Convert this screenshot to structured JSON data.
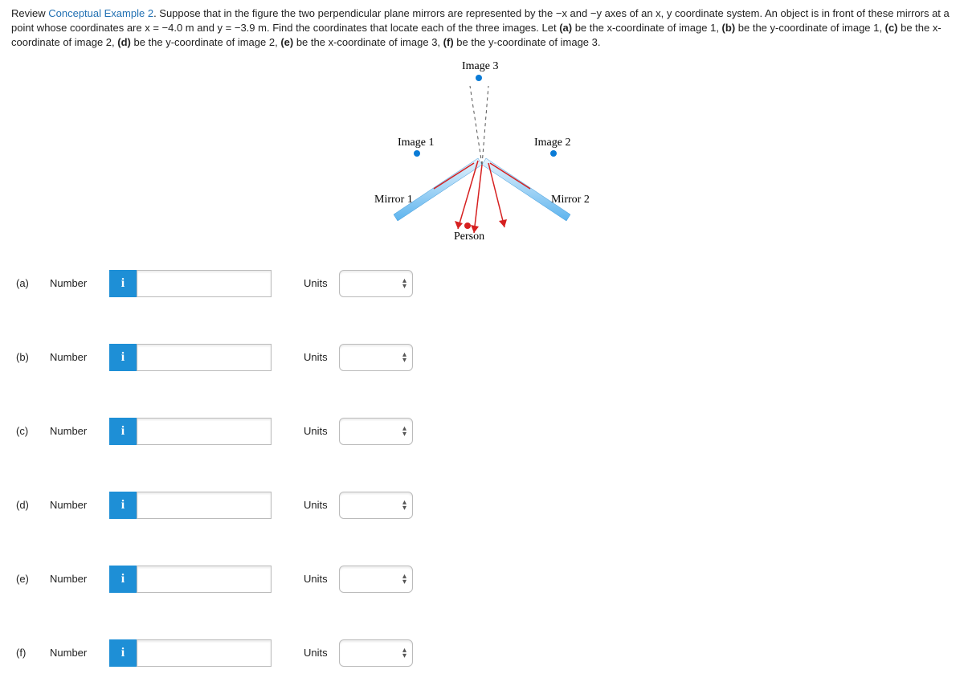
{
  "question": {
    "prefix": "Review ",
    "link": "Conceptual Example 2",
    "body1": ". Suppose that in the figure the two perpendicular plane mirrors are represented by the −x and −y axes of an x, y coordinate system. An object is in front of these mirrors at a point whose coordinates are x = −4.0 m and y = −3.9 m. Find the coordinates that locate each of the three images. Let ",
    "pa": "(a)",
    "ta": " be the x-coordinate of image 1, ",
    "pb": "(b)",
    "tb": " be the y-coordinate of image 1, ",
    "pc": "(c)",
    "tc": " be the x-coordinate of image 2, ",
    "pd": "(d)",
    "td": " be the y-coordinate of image 2, ",
    "pe": "(e)",
    "te": " be the x-coordinate of image 3, ",
    "pf": "(f)",
    "tf": " be the y-coordinate of image 3."
  },
  "figure": {
    "image3": "Image 3",
    "image1": "Image 1",
    "image2": "Image 2",
    "mirror1": "Mirror 1",
    "mirror2": "Mirror 2",
    "person": "Person"
  },
  "rows": [
    {
      "part": "(a)",
      "num": "Number",
      "info": "i",
      "units": "Units",
      "value": ""
    },
    {
      "part": "(b)",
      "num": "Number",
      "info": "i",
      "units": "Units",
      "value": ""
    },
    {
      "part": "(c)",
      "num": "Number",
      "info": "i",
      "units": "Units",
      "value": ""
    },
    {
      "part": "(d)",
      "num": "Number",
      "info": "i",
      "units": "Units",
      "value": ""
    },
    {
      "part": "(e)",
      "num": "Number",
      "info": "i",
      "units": "Units",
      "value": ""
    },
    {
      "part": "(f)",
      "num": "Number",
      "info": "i",
      "units": "Units",
      "value": ""
    }
  ],
  "icons": {
    "select_arrows": "▴\n▾"
  }
}
